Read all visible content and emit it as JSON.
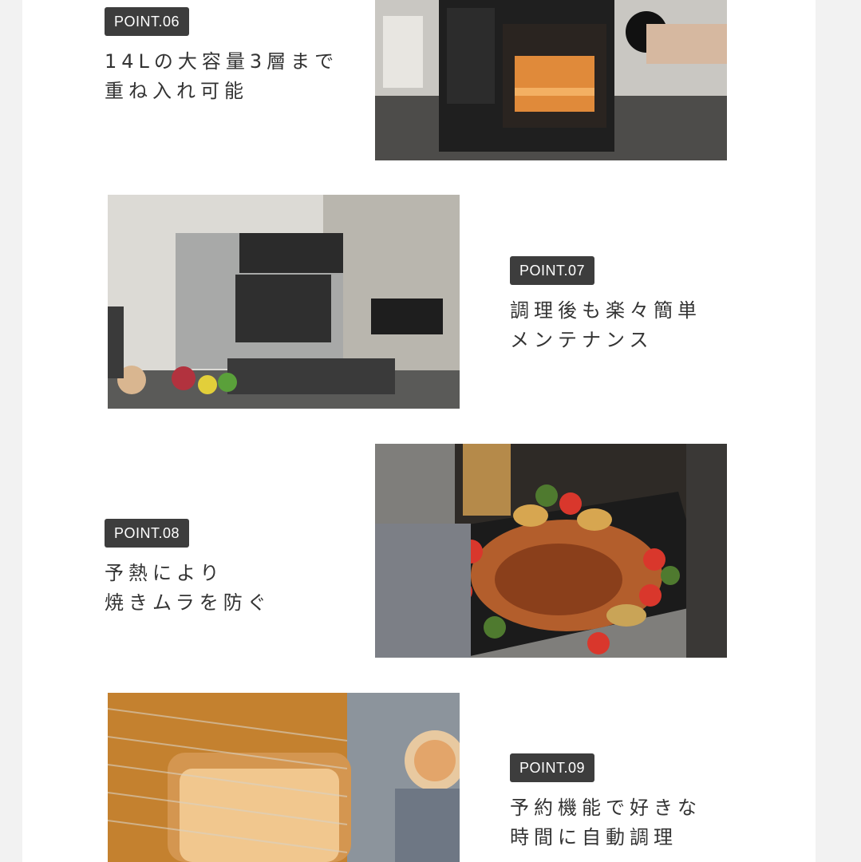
{
  "points": [
    {
      "badge": "POINT.06",
      "lines": [
        "14Lの大容量3層まで",
        "重ね入れ可能"
      ]
    },
    {
      "badge": "POINT.07",
      "lines": [
        "調理後も楽々簡単",
        "メンテナンス"
      ]
    },
    {
      "badge": "POINT.08",
      "lines": [
        "予熱により",
        "焼きムラを防ぐ"
      ]
    },
    {
      "badge": "POINT.09",
      "lines": [
        "予約機能で好きな",
        "時間に自動調理"
      ]
    }
  ],
  "colors": {
    "badge_bg": "#3d3d3d",
    "text": "#333333",
    "page_bg": "#ffffff"
  }
}
